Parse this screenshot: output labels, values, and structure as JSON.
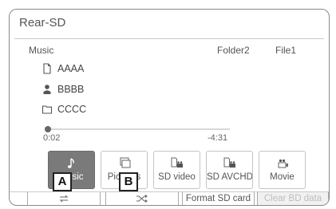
{
  "screen": {
    "title": "Rear-SD"
  },
  "track": {
    "source": "Music",
    "folder": "Folder2",
    "file": "File1",
    "title": "AAAA",
    "artist": "BBBB",
    "album": "CCCC",
    "elapsed": "0:02",
    "remaining": "-4:31",
    "progress_fraction": 0.01
  },
  "sources": [
    {
      "label": "Music",
      "icon": "music-note-icon",
      "active": true
    },
    {
      "label": "Pictures",
      "icon": "pictures-icon",
      "active": false
    },
    {
      "label": "SD video",
      "icon": "sd-video-icon",
      "active": false
    },
    {
      "label": "SD AVCHD",
      "icon": "sd-avchd-icon",
      "active": false
    },
    {
      "label": "Movie",
      "icon": "movie-icon",
      "active": false
    }
  ],
  "callouts": {
    "a": "A",
    "b": "B"
  },
  "controls": {
    "repeat_icon": "repeat-icon",
    "shuffle_icon": "shuffle-icon",
    "format_label": "Format SD card",
    "clear_label": "Clear BD data"
  },
  "colors": {
    "active_bg": "#7a7a7a",
    "frame": "#8a8a8a",
    "disabled_text": "#bdbdbd"
  }
}
